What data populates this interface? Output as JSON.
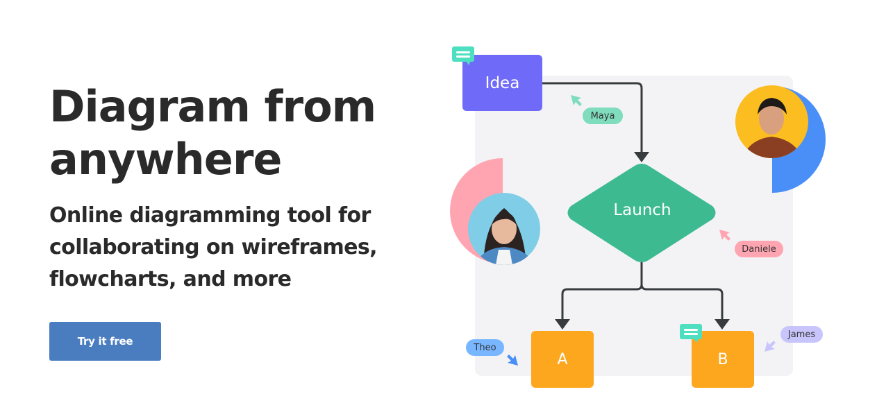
{
  "hero": {
    "title": "Diagram from anywhere",
    "subtitle": "Online diagramming tool for collaborating on wireframes, flowcharts, and more",
    "cta_label": "Try it free"
  },
  "diagram": {
    "nodes": {
      "idea": "Idea",
      "launch": "Launch",
      "a": "A",
      "b": "B"
    },
    "collaborators": {
      "maya": "Maya",
      "daniele": "Daniele",
      "theo": "Theo",
      "james": "James"
    },
    "colors": {
      "idea": "#6f6af8",
      "launch": "#3dba90",
      "option": "#fda71f",
      "connector": "#373b3e",
      "canvas": "#f3f3f6",
      "comment": "#4ddfc0",
      "cta": "#4a7dc0"
    }
  }
}
